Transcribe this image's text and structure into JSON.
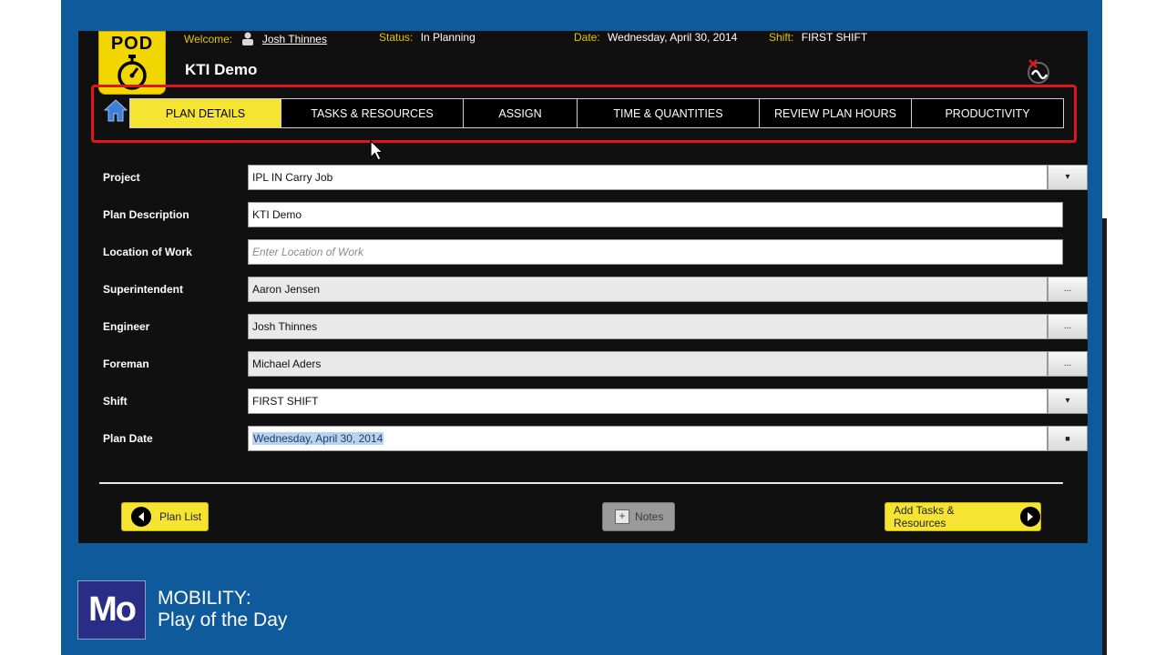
{
  "header": {
    "welcome_label": "Welcome:",
    "user_name": "Josh Thinnes",
    "status_label": "Status:",
    "status_value": "In Planning",
    "date_label": "Date:",
    "date_value": "Wednesday, April 30, 2014",
    "shift_label": "Shift:",
    "shift_value": "FIRST SHIFT",
    "logo_text": "POD",
    "title": "KTI Demo"
  },
  "tabs": [
    {
      "label": "PLAN DETAILS",
      "active": true
    },
    {
      "label": "TASKS & RESOURCES",
      "active": false
    },
    {
      "label": "ASSIGN",
      "active": false
    },
    {
      "label": "TIME & QUANTITIES",
      "active": false
    },
    {
      "label": "REVIEW PLAN HOURS",
      "active": false
    },
    {
      "label": "PRODUCTIVITY",
      "active": false
    }
  ],
  "form": {
    "project": {
      "label": "Project",
      "value": "IPL IN Carry Job",
      "button": "▾"
    },
    "plan_description": {
      "label": "Plan Description",
      "value": "KTI Demo"
    },
    "location_of_work": {
      "label": "Location of Work",
      "placeholder": "Enter Location of Work"
    },
    "superintendent": {
      "label": "Superintendent",
      "value": "Aaron Jensen",
      "button": "..."
    },
    "engineer": {
      "label": "Engineer",
      "value": "Josh Thinnes",
      "button": "..."
    },
    "foreman": {
      "label": "Foreman",
      "value": "Michael Aders",
      "button": "..."
    },
    "shift": {
      "label": "Shift",
      "value": "FIRST SHIFT",
      "button": "▾"
    },
    "plan_date": {
      "label": "Plan Date",
      "value": "Wednesday, April 30, 2014",
      "button": "■"
    }
  },
  "buttons": {
    "plan_list": "Plan List",
    "notes": "Notes",
    "add_tasks": "Add Tasks & Resources"
  },
  "branding": {
    "logo": "Mo",
    "line1": "MOBILITY:",
    "line2": "Play of the Day"
  },
  "colors": {
    "frame_blue": "#0f5a9b",
    "accent_yellow": "#f5e431",
    "highlight_red": "#e0141e"
  }
}
